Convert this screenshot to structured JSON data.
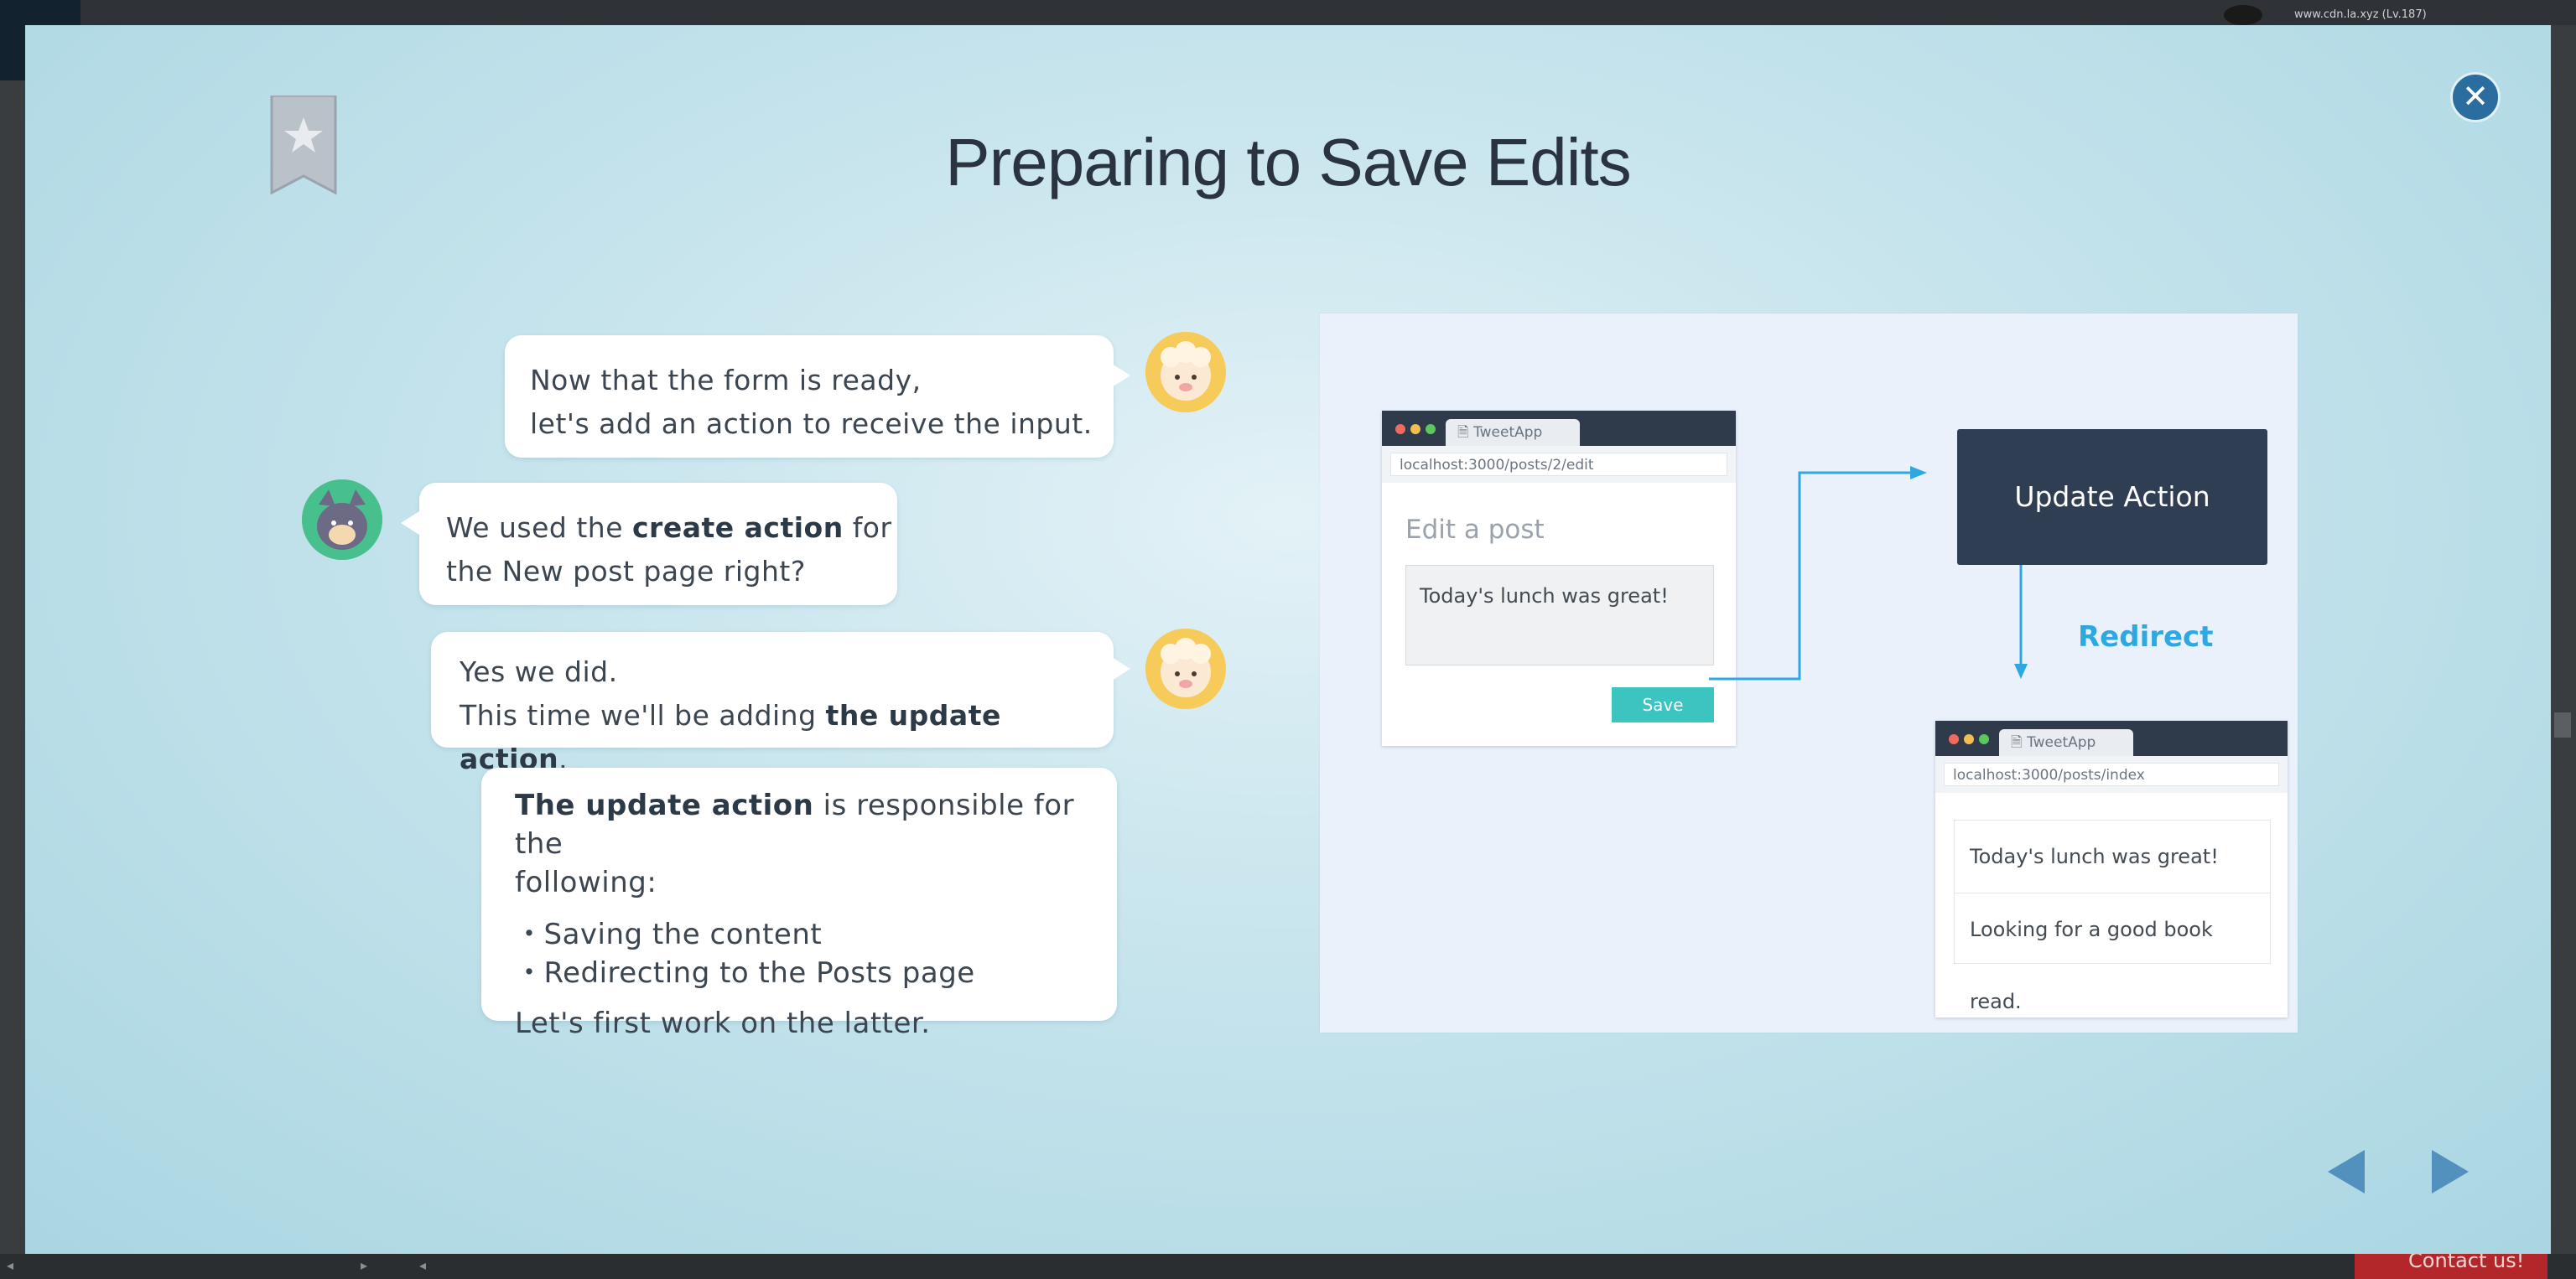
{
  "background": {
    "user_label": "www.cdn.la.xyz (Lv.187)",
    "contact_label": "Contact us!"
  },
  "slide": {
    "title": "Preparing to Save Edits",
    "bookmark_icon": "bookmark-star-icon",
    "close_icon": "close-icon"
  },
  "chat": [
    {
      "speaker": "sheep",
      "lines": [
        "Now that the form is ready,",
        "let's add an action to receive the input."
      ]
    },
    {
      "speaker": "cat",
      "line1_pre": "We used the ",
      "line1_bold": "create action",
      "line1_post": " for",
      "line2": "the New post page right?"
    },
    {
      "speaker": "sheep",
      "line1": "Yes we did.",
      "line2_pre": "This time we'll be adding ",
      "line2_bold": "the update action",
      "line2_post": "."
    },
    {
      "bold": "The update action",
      "rest": " is responsible for the",
      "line2": "following:",
      "items": [
        "・Saving the content",
        "・Redirecting to the Posts page"
      ],
      "last": "Let's first work on the latter."
    }
  ],
  "diagram": {
    "edit_window": {
      "tab": "TweetApp",
      "url": "localhost:3000/posts/2/edit",
      "heading": "Edit a post",
      "textarea": "Today's lunch was great!",
      "save": "Save"
    },
    "update_box": "Update Action",
    "redirect": "Redirect",
    "index_window": {
      "tab": "TweetApp",
      "url": "localhost:3000/posts/index",
      "rows": [
        "Today's lunch was great!",
        "Looking for a good book read."
      ]
    },
    "colors": {
      "arrow": "#2ea8e0",
      "dark": "#2f3e52",
      "save": "#3cc4c0"
    }
  },
  "navigation": {
    "prev_icon": "prev-triangle-icon",
    "next_icon": "next-triangle-icon"
  }
}
